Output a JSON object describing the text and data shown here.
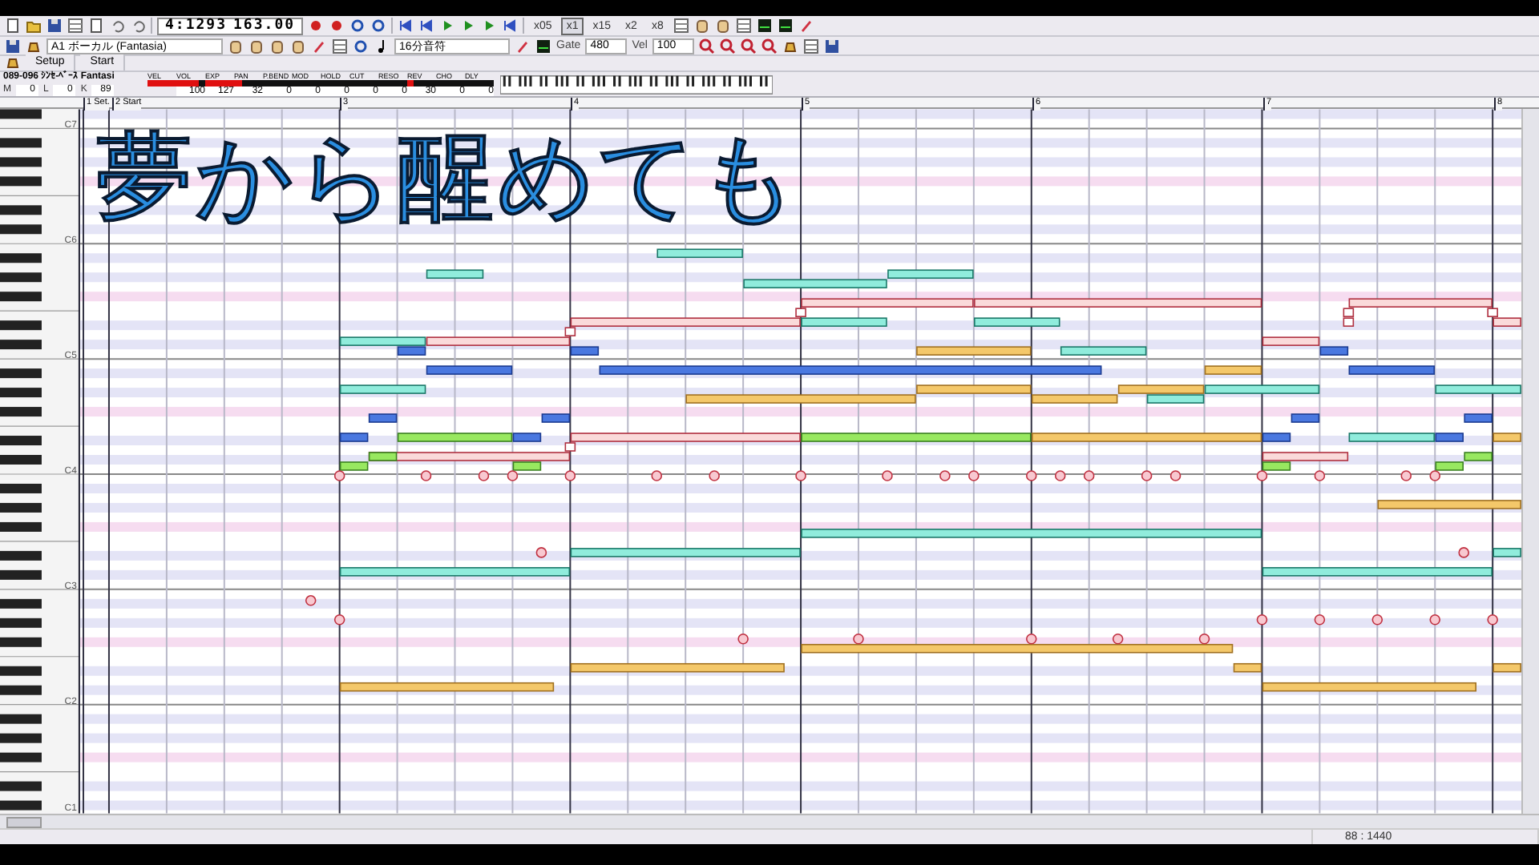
{
  "toolbar": {
    "position": "4:1293",
    "tempo": "163.00",
    "zoom_buttons": [
      {
        "label": "x05",
        "selected": false
      },
      {
        "label": "x1",
        "selected": true
      },
      {
        "label": "x15",
        "selected": false
      },
      {
        "label": "x2",
        "selected": false
      },
      {
        "label": "x8",
        "selected": false
      }
    ]
  },
  "track_bar": {
    "track": "A1 ボーカル (Fantasia)",
    "note_length": "16分音符",
    "gate_label": "Gate",
    "gate": "480",
    "vel_label": "Vel",
    "vel": "100"
  },
  "marker_buttons": [
    "Setup",
    "Start"
  ],
  "track_info": {
    "name": "089-096 ｼﾝｾ-ﾍﾞｰｽ Fantasi",
    "fields": [
      {
        "label": "M",
        "value": "0"
      },
      {
        "label": "L",
        "value": "0"
      },
      {
        "label": "K",
        "value": "89"
      }
    ],
    "meters": [
      {
        "name": "VEL",
        "level": 1
      },
      {
        "name": "VOL",
        "level": 0.79,
        "reading": "100"
      },
      {
        "name": "EXP",
        "level": 1,
        "reading": "127"
      },
      {
        "name": "PAN",
        "level": 0.25,
        "reading": "32"
      },
      {
        "name": "P.BEND",
        "level": 0,
        "reading": "0"
      },
      {
        "name": "MOD",
        "level": 0,
        "reading": "0"
      },
      {
        "name": "HOLD",
        "level": 0,
        "reading": "0"
      },
      {
        "name": "CUT",
        "level": 0,
        "reading": "0"
      },
      {
        "name": "RESO",
        "level": 0,
        "reading": "0"
      },
      {
        "name": "REV",
        "level": 0.24,
        "reading": "30"
      },
      {
        "name": "CHO",
        "level": 0,
        "reading": "0"
      },
      {
        "name": "DLY",
        "level": 0,
        "reading": "0"
      }
    ]
  },
  "ruler": [
    "1 Set.",
    "2 Start",
    "3",
    "4",
    "5",
    "6",
    "7",
    "8"
  ],
  "keyboard": {
    "octave_labels": [
      "C7",
      "C6",
      "C5",
      "C4",
      "C3",
      "C2",
      "C1"
    ]
  },
  "caption": "夢から醒めても",
  "status_bar": {
    "position": "88 : 1440"
  }
}
